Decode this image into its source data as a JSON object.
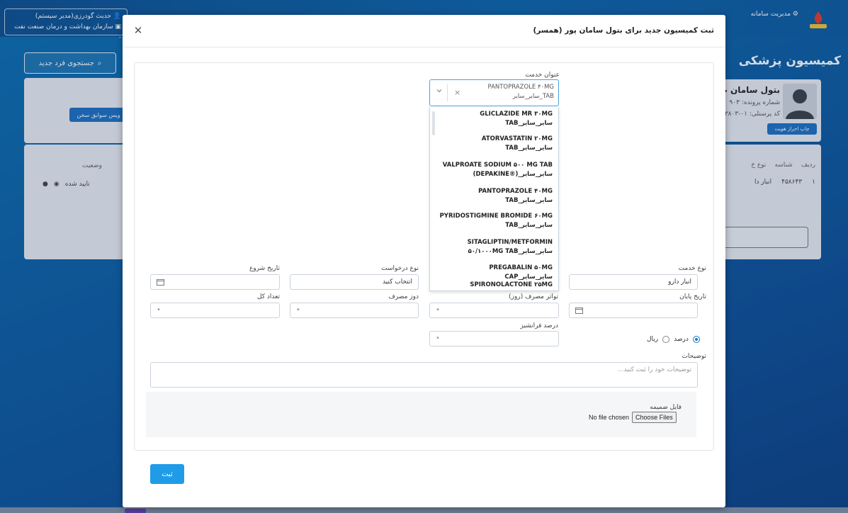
{
  "topbar": {
    "user_name": "حدیث گودرزی(مدیر سیستم)",
    "organization": "سازمان بهداشت و درمان صنعت نفت -",
    "nav_item": "مدیریت سامانه"
  },
  "background": {
    "search_new_label": "جستجوی فرد جدید",
    "history_button": "ویس سوابق سخن",
    "status_header": "وضعیت",
    "status_value": "تایید شده",
    "page_title": "کمیسیون پزشکی",
    "profile": {
      "name": "بتول سامان پ",
      "file_number": "شماره پرونده: ۹۰۳",
      "personnel_code": "کد پرسنلی: ۰۱-۳۸۰۳",
      "print_button": "چاپ احراز هویت"
    },
    "table_headers": [
      "ردیف",
      "شناسه",
      "نوع خ"
    ],
    "table_row": [
      "۱",
      "۴۵۸۶۴۳",
      "انبار دا"
    ]
  },
  "modal": {
    "title": "ثبت کمیسیون جدید برای بتول سامان پور (همسر)",
    "service_title_label": "عنوان خدمت",
    "service_selected": "PANTOPRAZOLE ۴۰MG TAB_سایر_سایر",
    "dropdown_options": [
      "GLICLAZIDE MR ۳۰MG TAB_سایر_سایر",
      "ATORVASTATIN ۲۰MG TAB_سایر_سایر",
      "VALPROATE SODIUM ۵۰۰ MG TAB (DEPAKINE®)_سایر_سایر",
      "PANTOPRAZOLE ۴۰MG TAB_سایر_سایر",
      "PYRIDOSTIGMINE BROMIDE ۶۰MG TAB_سایر_سایر",
      "SITAGLIPTIN/METFORMIN ۵۰/۱۰۰۰MG TAB_سایر_سایر",
      "PREGABALIN ۵۰MG CAP_سایر_سایر",
      "SPIRONOLACTONE ۲۵MG"
    ],
    "service_type_label": "نوع خدمت",
    "service_type_value": "انبار دارو",
    "request_type_label": "نوع درخواست",
    "request_type_value": "انتخاب کنید",
    "start_date_label": "تاریخ شروع",
    "end_date_label": "تاریخ پایان",
    "frequency_label": "تواتر مصرف (روز)",
    "dose_label": "دوز مصرف",
    "total_count_label": "تعداد کل",
    "franchise_label": "درصد فرانشیز",
    "radio_percent": "درصد",
    "radio_rial": "ریال",
    "description_label": "توضیحات",
    "description_placeholder": "توضیحات خود را ثبت کنید...",
    "attachment_label": "فایل ضمیمه",
    "choose_files": "Choose Files",
    "no_file": "No file chosen",
    "submit": "ثبت"
  },
  "colors": {
    "primary": "#1f9be8",
    "focus_border": "#4aa3df",
    "background_blue": "#0b5fa3"
  }
}
